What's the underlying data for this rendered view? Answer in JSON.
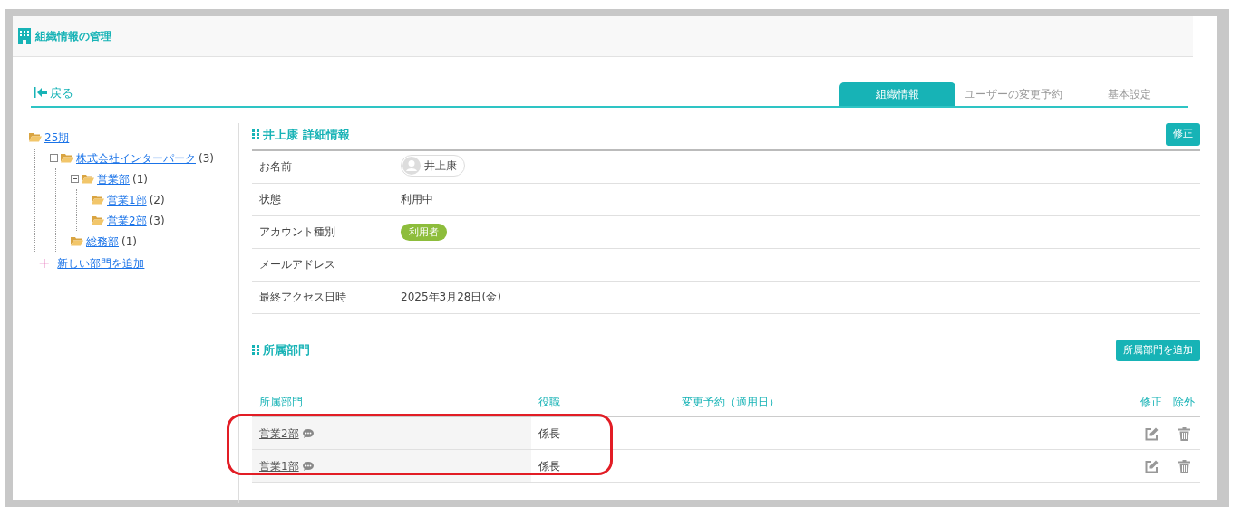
{
  "header": {
    "title": "組織情報の管理"
  },
  "back_link": {
    "label": "戻る"
  },
  "tabs": [
    {
      "label": "組織情報",
      "selected": true
    },
    {
      "label": "ユーザーの変更予約",
      "selected": false
    },
    {
      "label": "基本設定",
      "selected": false
    }
  ],
  "tree": [
    {
      "label": "25期",
      "children": [
        {
          "label": "株式会社インターパーク",
          "count": "(3)",
          "expanded": true,
          "children": [
            {
              "label": "営業部",
              "count": "(1)",
              "expanded": true,
              "children": [
                {
                  "label": "営業1部",
                  "count": "(2)"
                },
                {
                  "label": "営業2部",
                  "count": "(3)"
                }
              ]
            },
            {
              "label": "総務部",
              "count": "(1)"
            }
          ]
        }
      ]
    }
  ],
  "add_department_link": {
    "icon": "+",
    "label": "新しい部門を追加"
  },
  "detail": {
    "title": "井上康 詳細情報",
    "edit_button": "修正",
    "rows": [
      {
        "label": "お名前",
        "kind": "user-chip",
        "value": "井上康"
      },
      {
        "label": "状態",
        "kind": "text",
        "value": "利用中"
      },
      {
        "label": "アカウント種別",
        "kind": "badge",
        "value": "利用者"
      },
      {
        "label": "メールアドレス",
        "kind": "text"
      },
      {
        "label": "最終アクセス日時",
        "kind": "text",
        "value": "2025年3月28日(金)"
      }
    ]
  },
  "departments": {
    "title": "所属部門",
    "add_button": "所属部門を追加",
    "columns": [
      "所属部門",
      "役職",
      "変更予約（適用日）",
      "修正",
      "除外"
    ],
    "rows": [
      {
        "department": "営業2部",
        "position": "係長"
      },
      {
        "department": "営業1部",
        "position": "係長"
      }
    ]
  }
}
